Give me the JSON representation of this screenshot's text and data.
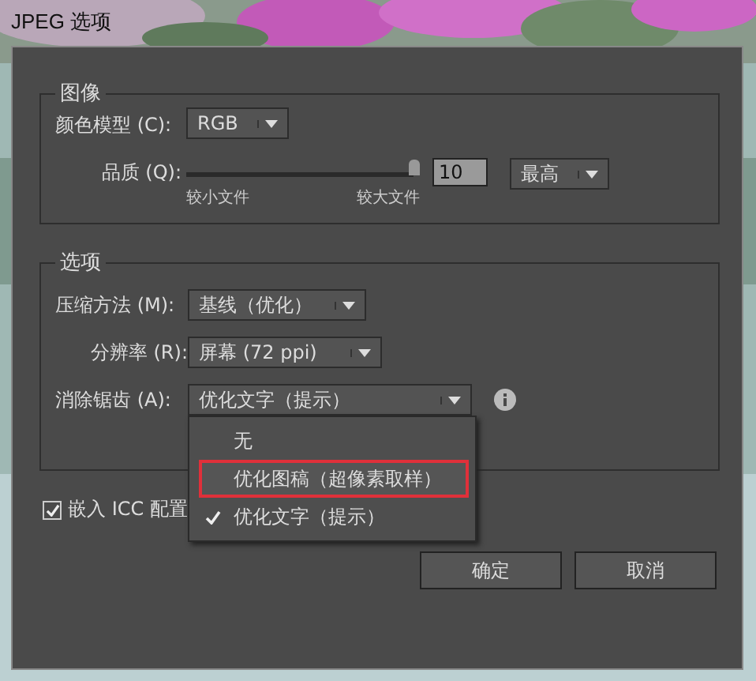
{
  "window": {
    "title": "JPEG 选项"
  },
  "image_group": {
    "title": "图像",
    "color_mode": {
      "label": "颜色模型 (C):",
      "value": "RGB"
    },
    "quality": {
      "label": "品质 (Q):",
      "level": 1,
      "value": "10",
      "preset": "最高",
      "min_label": "较小文件",
      "max_label": "较大文件"
    }
  },
  "options_group": {
    "title": "选项",
    "fields": [
      {
        "label": "压缩方法 (M):",
        "value": "基线（优化）",
        "kind": "select"
      },
      {
        "label": "分辨率 (R):",
        "value": "屏幕 (72 ppi)",
        "kind": "select"
      },
      {
        "label": "消除锯齿 (A):",
        "value": "优化文字（提示）",
        "kind": "menu-select"
      }
    ]
  },
  "menu": {
    "items": [
      {
        "label": "无",
        "selected": false,
        "outlined": false
      },
      {
        "label": "优化图稿（超像素取样）",
        "selected": false,
        "outlined": true
      },
      {
        "label": "优化文字（提示）",
        "selected": true,
        "outlined": false
      }
    ]
  },
  "embed_icc": {
    "label": "嵌入 ICC 配置",
    "checked": true
  },
  "buttons": [
    "确定",
    "取消"
  ]
}
